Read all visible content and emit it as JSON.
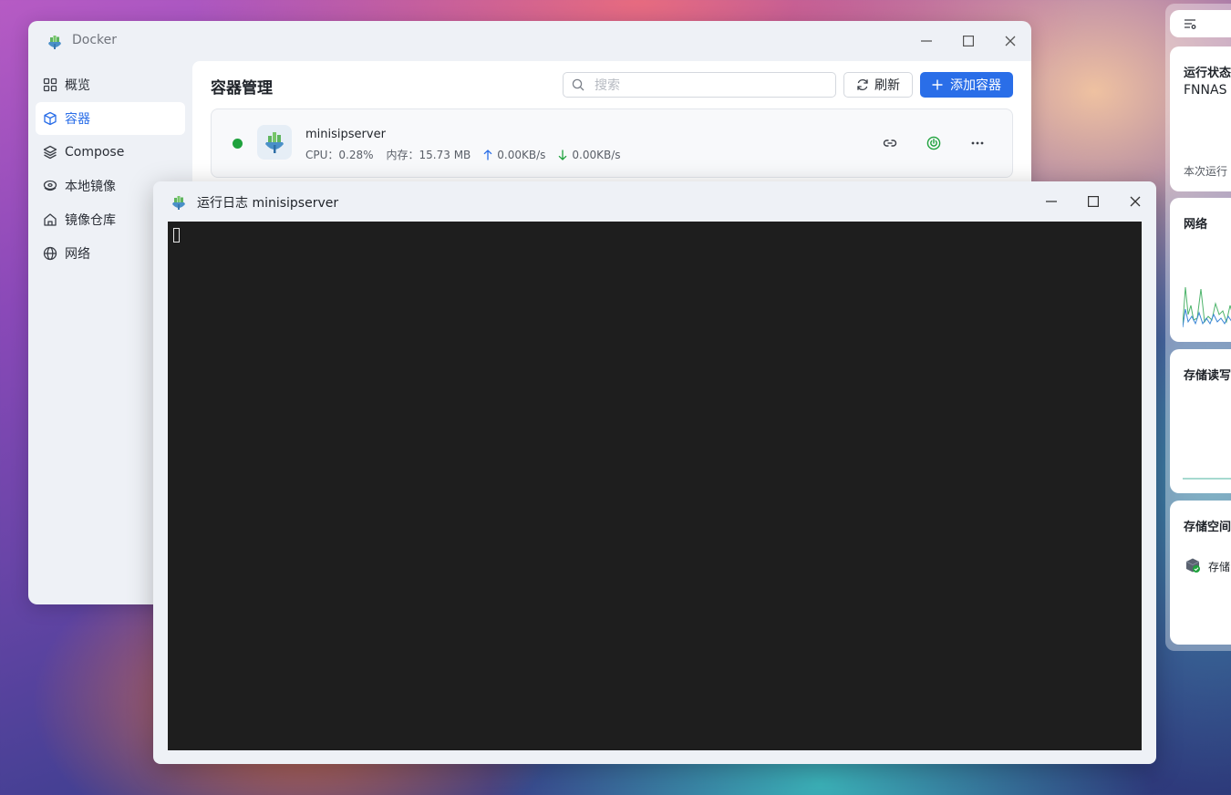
{
  "docker_window": {
    "title": "Docker",
    "sidebar": {
      "items": [
        {
          "label": "概览"
        },
        {
          "label": "容器"
        },
        {
          "label": "Compose"
        },
        {
          "label": "本地镜像"
        },
        {
          "label": "镜像仓库"
        },
        {
          "label": "网络"
        }
      ],
      "active": "容器"
    },
    "page_title": "容器管理",
    "search": {
      "placeholder": "搜索",
      "value": ""
    },
    "refresh_label": "刷新",
    "add_label": "添加容器",
    "container": {
      "name": "minisipserver",
      "status_color": "#1fa23d",
      "cpu": "CPU：0.28%",
      "memory": "内存：15.73 MB",
      "upload": "0.00KB/s",
      "download": "0.00KB/s"
    }
  },
  "log_window": {
    "title": "运行日志 minisipserver"
  },
  "widgets": {
    "menu_icon": "list-settings-icon",
    "running_status": {
      "title": "运行状态",
      "host": "FNNAS",
      "uptime_label": "本次运行"
    },
    "network": {
      "title": "网络"
    },
    "storage_io": {
      "title": "存储读写"
    },
    "storage_space": {
      "title": "存储空间",
      "item_label": "存储"
    }
  },
  "colors": {
    "accent": "#2a6ee8",
    "terminal_bg": "#1e1e1e",
    "running": "#1fa23d"
  }
}
